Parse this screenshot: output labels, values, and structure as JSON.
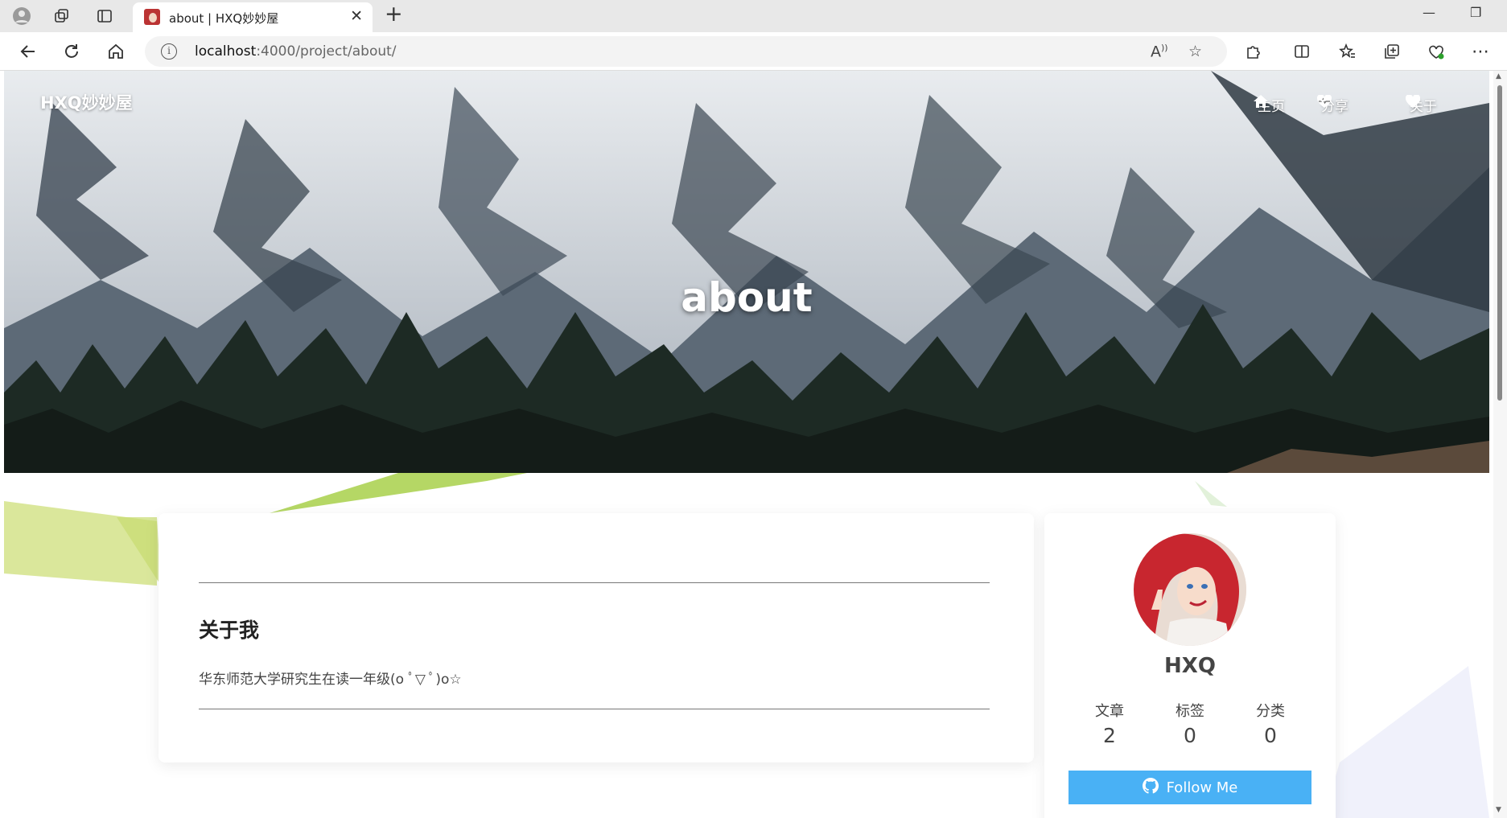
{
  "browser": {
    "tab_title": "about | HXQ妙妙屋",
    "url_host": "localhost",
    "url_path": ":4000/project/about/"
  },
  "site": {
    "brand": "HXQ妙妙屋",
    "menu": [
      {
        "label": "主页",
        "icon": "home-icon"
      },
      {
        "label": "分享",
        "icon": "heartbeat-icon"
      },
      {
        "label": "关于",
        "icon": "heart-icon"
      }
    ],
    "page_title": "about"
  },
  "content": {
    "heading": "关于我",
    "paragraph": "华东师范大学研究生在读一年级(o ﾟ▽ ﾟ)o☆"
  },
  "sidebar": {
    "author": "HXQ",
    "stats": [
      {
        "label": "文章",
        "value": "2"
      },
      {
        "label": "标签",
        "value": "0"
      },
      {
        "label": "分类",
        "value": "0"
      }
    ],
    "follow_label": "Follow Me"
  },
  "colors": {
    "accent": "#49b1f5",
    "deco_green": "#c7e07a"
  }
}
